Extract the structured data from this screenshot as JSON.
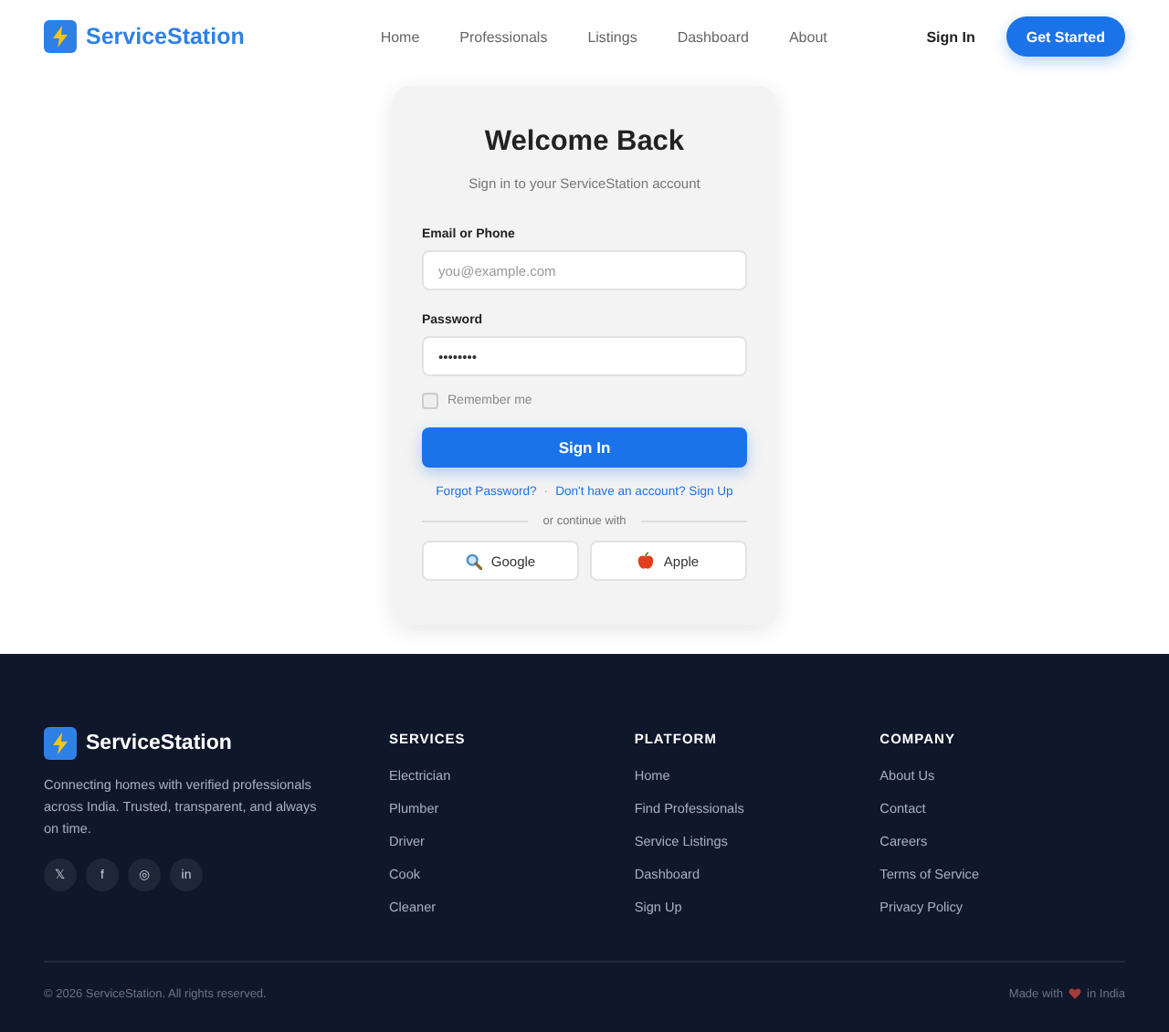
{
  "header": {
    "brand": "ServiceStation",
    "nav": [
      {
        "label": "Home",
        "selected": false
      },
      {
        "label": "Professionals",
        "selected": false
      },
      {
        "label": "Listings",
        "selected": false
      },
      {
        "label": "Dashboard",
        "selected": false
      },
      {
        "label": "About",
        "selected": false
      }
    ],
    "sign_in": "Sign In",
    "get_started": "Get Started"
  },
  "login": {
    "title": "Welcome Back",
    "subtitle": "Sign in to your ServiceStation account",
    "fields": [
      {
        "label": "Email or Phone",
        "placeholder": "you@example.com"
      },
      {
        "label": "Password",
        "value": "••••••••"
      }
    ],
    "remember": {
      "label": "Remember me",
      "checked": false
    },
    "submit": "Sign In",
    "forgot": "Forgot Password?",
    "separator": "·",
    "signup": "Don't have an account? Sign Up",
    "divider": "or continue with",
    "providers": [
      {
        "kind": "search",
        "label": "Google"
      },
      {
        "kind": "apple",
        "label": "Apple"
      }
    ]
  },
  "footer": {
    "brand": "ServiceStation",
    "description": "Connecting homes with verified professionals across India. Trusted, transparent, and always on time.",
    "social": [
      "𝕏",
      "f",
      "◎",
      "in"
    ],
    "columns": [
      {
        "heading": "SERVICES",
        "links": [
          "Electrician",
          "Plumber",
          "Driver",
          "Cook",
          "Cleaner"
        ]
      },
      {
        "heading": "PLATFORM",
        "links": [
          "Home",
          "Find Professionals",
          "Service Listings",
          "Dashboard",
          "Sign Up"
        ]
      },
      {
        "heading": "COMPANY",
        "links": [
          "About Us",
          "Contact",
          "Careers",
          "Terms of Service",
          "Privacy Policy"
        ]
      }
    ],
    "copyright": "© 2026 ServiceStation. All rights reserved.",
    "made_with": "Made with",
    "made_in": "in India"
  }
}
